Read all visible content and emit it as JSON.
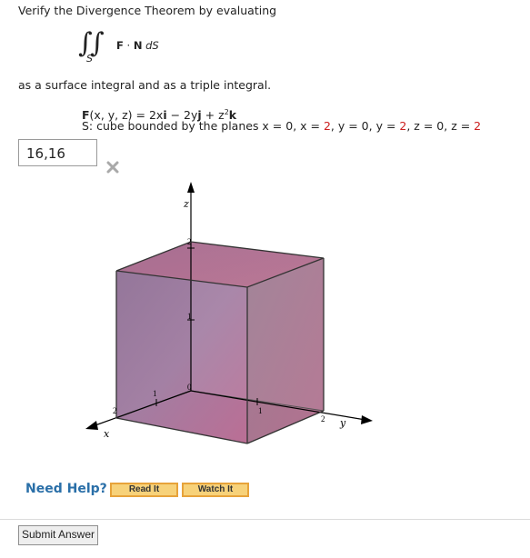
{
  "problem": {
    "prompt": "Verify the Divergence Theorem by evaluating",
    "integral": {
      "subscript": "S",
      "integrand_vector": "F",
      "dot": "·",
      "normal": "N",
      "differential": "dS"
    },
    "as_text": "as a surface integral and as a triple integral.",
    "field": {
      "lhs": "F",
      "args": "(x, y, z) = 2x",
      "i": "i",
      "minus": " − 2y",
      "j": "j",
      "plus": " + z",
      "exp": "2",
      "k": "k"
    },
    "surface": {
      "prefix": "S: cube bounded by the planes x = 0, x = ",
      "x2": "2",
      "mid1": ", y = 0, y = ",
      "y2": "2",
      "mid2": ", z = 0, z = ",
      "z2": "2"
    }
  },
  "answer": {
    "value": "16,16",
    "status": "incorrect",
    "status_icon": "x-icon"
  },
  "figure": {
    "axis_labels": {
      "x": "x",
      "y": "y",
      "z": "z"
    },
    "ticks": {
      "z": [
        "1",
        "2"
      ],
      "y": [
        "1",
        "2"
      ],
      "x": [
        "1",
        "2"
      ],
      "origin": "0"
    },
    "colors": {
      "cube_fill": "#9e5f8a",
      "cube_edge": "#3a3a3a"
    }
  },
  "help": {
    "label": "Need Help?",
    "read_button": "Read It",
    "watch_button": "Watch It"
  },
  "submit_button": "Submit Answer"
}
